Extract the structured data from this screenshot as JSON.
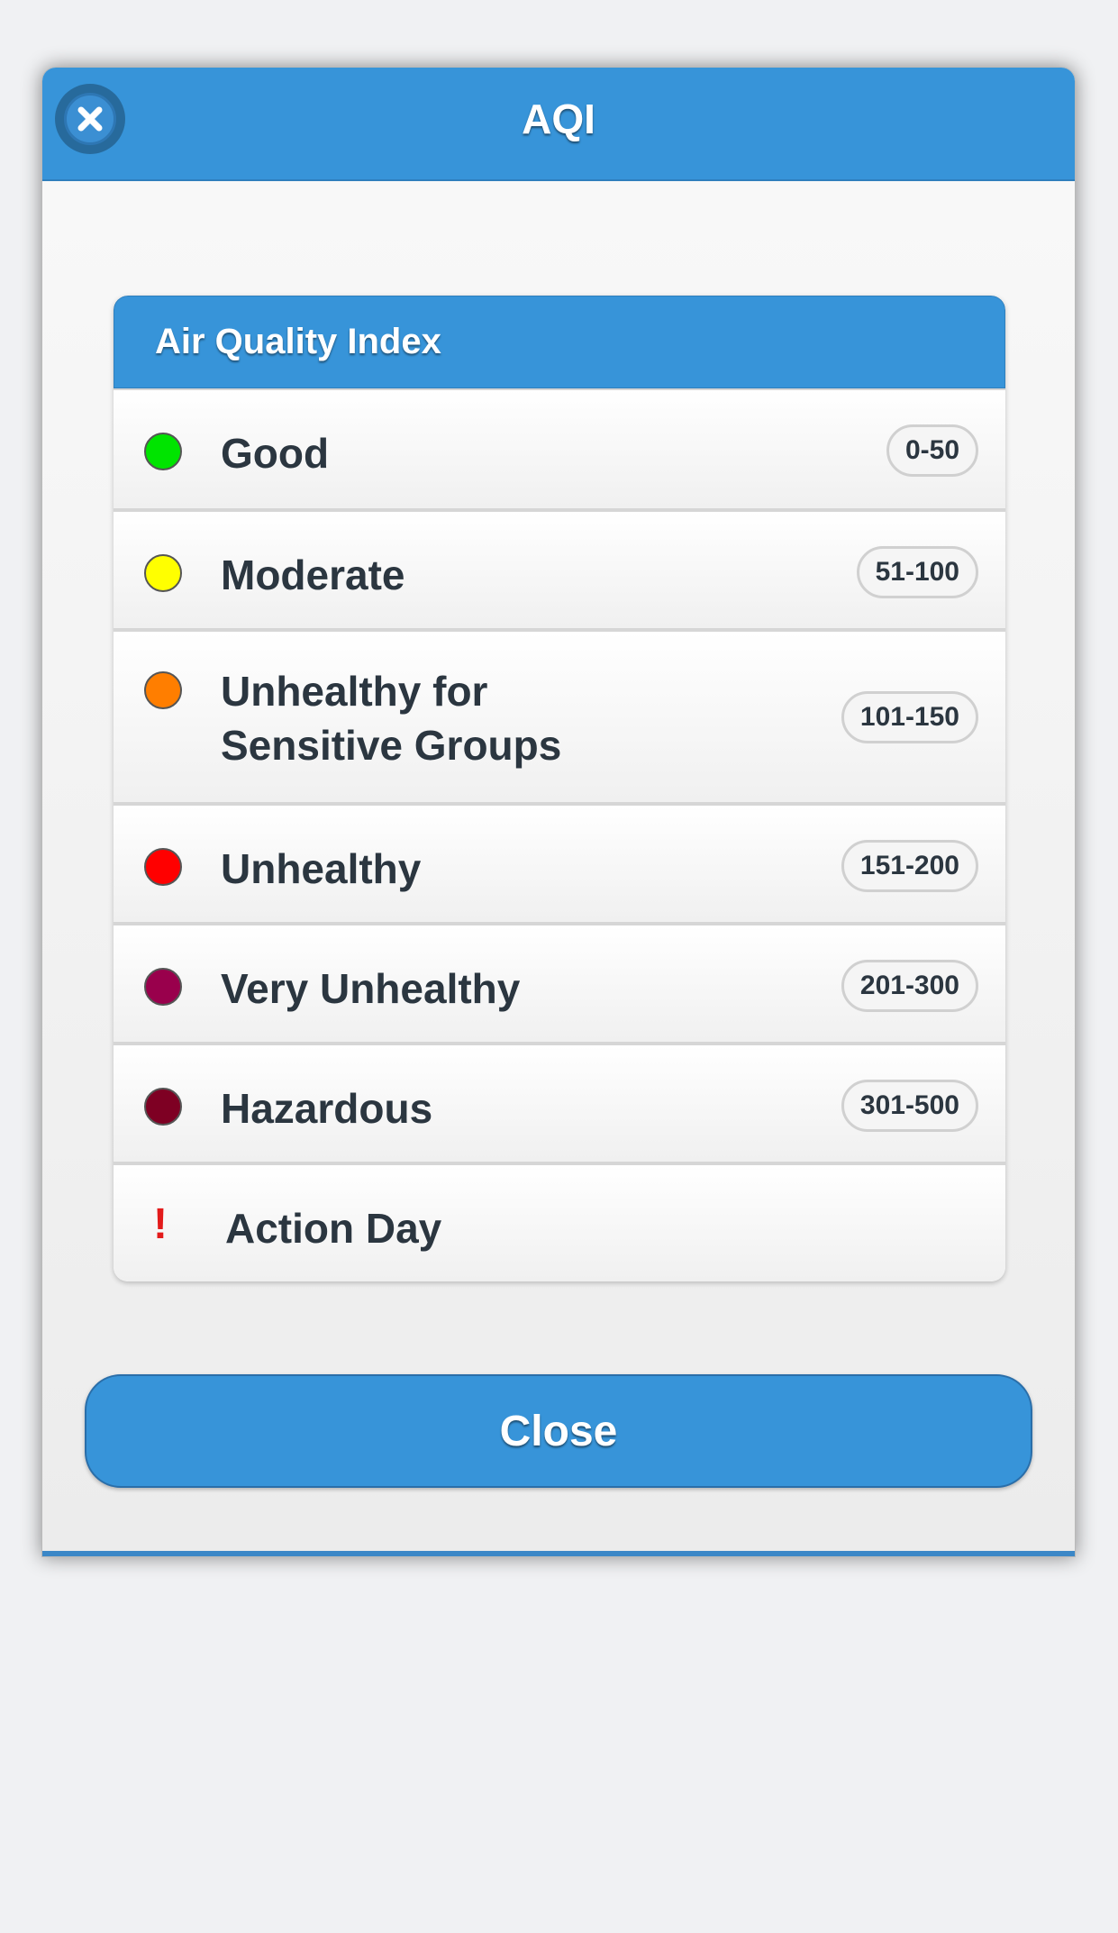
{
  "dialog": {
    "title": "AQI",
    "close_icon": "close-icon",
    "accent_color": "#3794d9"
  },
  "list": {
    "header": "Air Quality Index",
    "items": [
      {
        "label": "Good",
        "range": "0-50",
        "color": "#00e400"
      },
      {
        "label": "Moderate",
        "range": "51-100",
        "color": "#ffff00"
      },
      {
        "label": "Unhealthy for Sensitive Groups",
        "line1": "Unhealthy for",
        "line2": "Sensitive Groups",
        "range": "101-150",
        "color": "#ff7e00"
      },
      {
        "label": "Unhealthy",
        "range": "151-200",
        "color": "#ff0000"
      },
      {
        "label": "Very Unhealthy",
        "range": "201-300",
        "color": "#99004c"
      },
      {
        "label": "Hazardous",
        "range": "301-500",
        "color": "#7e0023"
      }
    ],
    "action_day": {
      "icon": "exclamation-icon",
      "symbol": "!",
      "label": "Action Day",
      "color": "#e31b1b"
    }
  },
  "footer": {
    "close_label": "Close"
  }
}
